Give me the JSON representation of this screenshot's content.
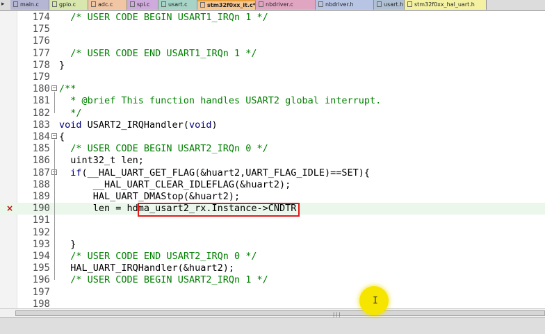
{
  "tabs": [
    {
      "label": "main.c",
      "color": "#b5b6d4"
    },
    {
      "label": "gpio.c",
      "color": "#d8e7ae"
    },
    {
      "label": "adc.c",
      "color": "#f0c6a4"
    },
    {
      "label": "spi.c",
      "color": "#cfaadc"
    },
    {
      "label": "usart.c",
      "color": "#a8d4c8"
    },
    {
      "label": "stm32f0xx_it.c*",
      "color": "#f7c793",
      "active": true
    },
    {
      "label": "nbdriver.c",
      "color": "#e0a6c1"
    },
    {
      "label": "nbdriver.h",
      "color": "#b8c4e4"
    },
    {
      "label": "usart.h",
      "color": "#b0c0d4"
    },
    {
      "label": "stm32f0xx_hal_uart.h",
      "color": "#f4f2a2"
    }
  ],
  "lines": [
    {
      "num": "174",
      "code": [
        {
          "t": "  "
        },
        {
          "t": "/* USER CODE BEGIN USART1_IRQn 1 */",
          "k": "c"
        }
      ]
    },
    {
      "num": "175",
      "code": []
    },
    {
      "num": "176",
      "code": []
    },
    {
      "num": "177",
      "code": [
        {
          "t": "  "
        },
        {
          "t": "/* USER CODE END USART1_IRQn 1 */",
          "k": "c"
        }
      ]
    },
    {
      "num": "178",
      "code": [
        {
          "t": "}"
        }
      ]
    },
    {
      "num": "179",
      "code": []
    },
    {
      "num": "180",
      "fold": "minus",
      "code": [
        {
          "t": "/**",
          "k": "c"
        }
      ]
    },
    {
      "num": "181",
      "code": [
        {
          "t": "  * @brief This function handles USART2 global interrupt.",
          "k": "c"
        }
      ]
    },
    {
      "num": "182",
      "code": [
        {
          "t": "  */",
          "k": "c"
        }
      ]
    },
    {
      "num": "183",
      "code": [
        {
          "t": "void",
          "k": "kw"
        },
        {
          "t": " USART2_IRQHandler("
        },
        {
          "t": "void",
          "k": "kw"
        },
        {
          "t": ")"
        }
      ]
    },
    {
      "num": "184",
      "fold": "minus",
      "code": [
        {
          "t": "{"
        }
      ]
    },
    {
      "num": "185",
      "code": [
        {
          "t": "  "
        },
        {
          "t": "/* USER CODE BEGIN USART2_IRQn 0 */",
          "k": "c"
        }
      ]
    },
    {
      "num": "186",
      "code": [
        {
          "t": "  uint32_t len;"
        }
      ]
    },
    {
      "num": "187",
      "fold": "minus",
      "code": [
        {
          "t": "  "
        },
        {
          "t": "if",
          "k": "kw"
        },
        {
          "t": "(__HAL_UART_GET_FLAG(&huart2,UART_FLAG_IDLE)==SET){"
        }
      ]
    },
    {
      "num": "188",
      "code": [
        {
          "t": "      __HAL_UART_CLEAR_IDLEFLAG(&huart2);"
        }
      ]
    },
    {
      "num": "189",
      "code": [
        {
          "t": "      HAL_UART_DMAStop(&huart2);"
        }
      ]
    },
    {
      "num": "190",
      "marker": "×",
      "highlight": true,
      "code": [
        {
          "t": "      len = hdma_usart2_rx.Instance->CNDTR"
        }
      ]
    },
    {
      "num": "191",
      "code": []
    },
    {
      "num": "192",
      "code": []
    },
    {
      "num": "193",
      "code": [
        {
          "t": "  }"
        }
      ]
    },
    {
      "num": "194",
      "code": [
        {
          "t": "  "
        },
        {
          "t": "/* USER CODE END USART2_IRQn 0 */",
          "k": "c"
        }
      ]
    },
    {
      "num": "195",
      "code": [
        {
          "t": "  HAL_UART_IRQHandler(&huart2);"
        }
      ]
    },
    {
      "num": "196",
      "code": [
        {
          "t": "  "
        },
        {
          "t": "/* USER CODE BEGIN USART2_IRQn 1 */",
          "k": "c"
        }
      ]
    },
    {
      "num": "197",
      "code": []
    },
    {
      "num": "198",
      "code": []
    }
  ],
  "scrollbar": {
    "grip": "|||"
  },
  "cursor": {
    "glyph": "I"
  }
}
